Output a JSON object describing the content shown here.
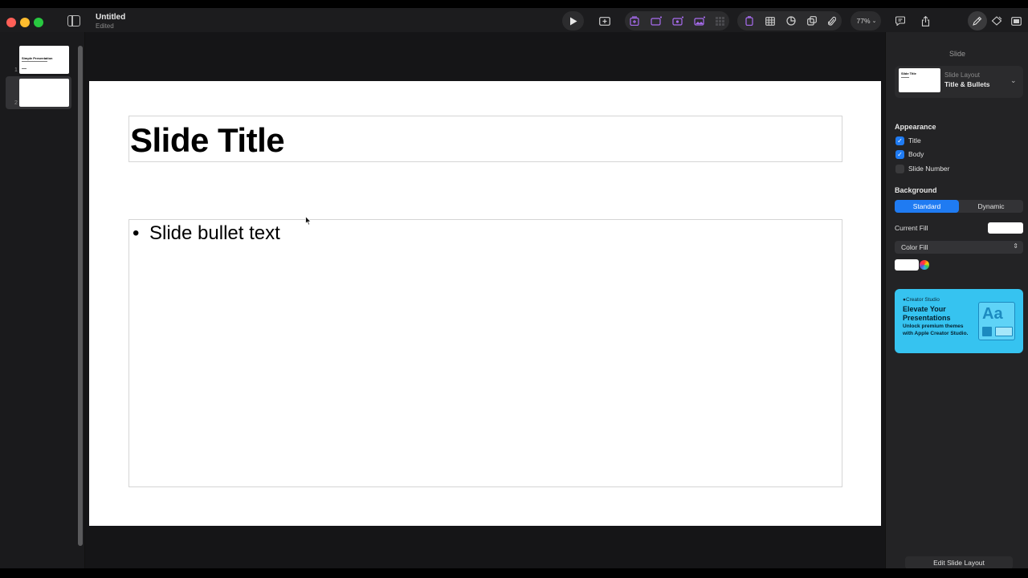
{
  "window": {
    "title": "Untitled",
    "subtitle": "Edited",
    "zoom": "77%"
  },
  "navigator": {
    "slides": [
      {
        "number": "1",
        "title": "Simple Presentation"
      },
      {
        "number": "2",
        "title": ""
      }
    ],
    "selected": 2
  },
  "slide": {
    "title": "Slide Title",
    "bullets": [
      "Slide bullet text"
    ]
  },
  "inspector": {
    "tab": "Slide",
    "layout": {
      "label": "Slide Layout",
      "value": "Title & Bullets"
    },
    "appearance": {
      "heading": "Appearance",
      "items": [
        {
          "label": "Title",
          "checked": true
        },
        {
          "label": "Body",
          "checked": true
        },
        {
          "label": "Slide Number",
          "checked": false
        }
      ]
    },
    "background": {
      "heading": "Background",
      "options": [
        "Standard",
        "Dynamic"
      ],
      "selected": "Standard",
      "current_fill_label": "Current Fill",
      "fill_type": "Color Fill",
      "fill_color": "#ffffff"
    },
    "promo": {
      "brand": "Creator Studio",
      "title": "Elevate Your Presentations",
      "text": "Unlock premium themes with Apple Creator Studio.",
      "art_text": "Aa"
    },
    "edit_layout_button": "Edit Slide Layout"
  },
  "colors": {
    "accent": "#1f7bf2",
    "promo_bg": "#36c3f0",
    "toolbar_purple": "#a86cf0"
  },
  "icons": {
    "toolbar": [
      "play-icon",
      "add-slide-icon",
      "animate-icon",
      "build-in-icon",
      "build-out-icon",
      "media-icon",
      "grid-icon",
      "shape-icon",
      "table-icon",
      "chart-icon",
      "layers-icon",
      "attachment-icon",
      "comment-icon",
      "share-icon",
      "format-icon",
      "animate-panel-icon",
      "document-icon"
    ]
  }
}
